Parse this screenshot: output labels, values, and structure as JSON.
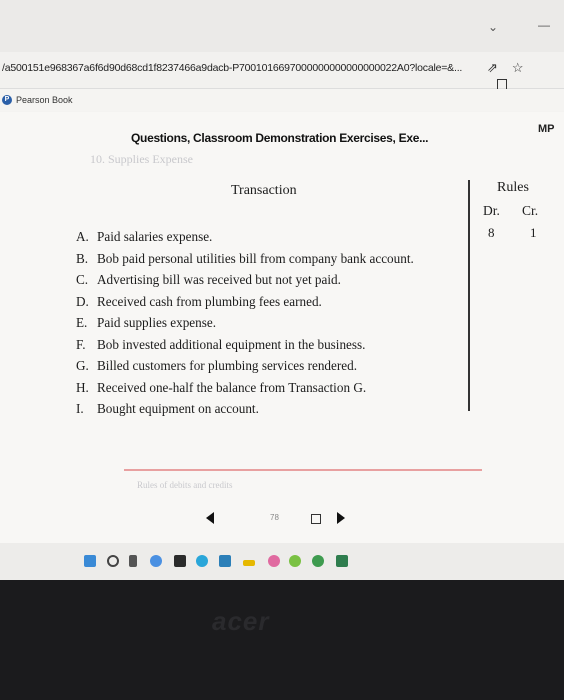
{
  "browser": {
    "url": "/a500151e968367a6f6d90d68cd1f8237466a9dacb-P7001016697000000000000000022A0?locale=&...",
    "bookmark": "Pearson Book"
  },
  "doc": {
    "title": "Questions, Classroom Demonstration Exercises, Exe...",
    "mp": "MP",
    "faded_heading": "10. Supplies Expense"
  },
  "table": {
    "header_transaction": "Transaction",
    "header_rules": "Rules",
    "header_dr": "Dr.",
    "header_cr": "Cr.",
    "dr_value": "8",
    "cr_value": "1",
    "items": [
      {
        "letter": "A.",
        "text": "Paid salaries expense."
      },
      {
        "letter": "B.",
        "text": "Bob paid personal utilities bill from company bank account."
      },
      {
        "letter": "C.",
        "text": "Advertising bill was received but not yet paid."
      },
      {
        "letter": "D.",
        "text": "Received cash from plumbing fees earned."
      },
      {
        "letter": "E.",
        "text": "Paid supplies expense."
      },
      {
        "letter": "F.",
        "text": "Bob invested additional equipment in the business."
      },
      {
        "letter": "G.",
        "text": "Billed customers for plumbing services rendered."
      },
      {
        "letter": "H.",
        "text": "Received one-half the balance from Transaction G."
      },
      {
        "letter": "I.",
        "text": "Bought equipment on account."
      }
    ]
  },
  "footer": {
    "faded_text": "Rules of debits and credits",
    "page_number": "78"
  },
  "colors": {
    "accent_red": "#e8a0a0",
    "pearson_blue": "#2b5fa8"
  }
}
